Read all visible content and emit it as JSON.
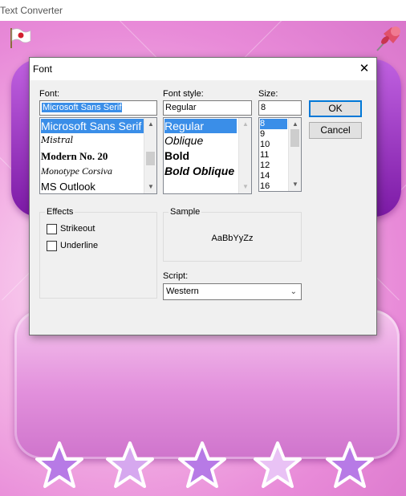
{
  "app": {
    "title": "Text Converter"
  },
  "dialog": {
    "title": "Font",
    "close_glyph": "✕",
    "font": {
      "label": "Font:",
      "value": "Microsoft Sans Serif",
      "items": [
        "Microsoft Sans Serif",
        "Mistral",
        "Modern No. 20",
        "Monotype Corsiva",
        "MS Outlook"
      ],
      "selected": "Microsoft Sans Serif"
    },
    "style": {
      "label": "Font style:",
      "value": "Regular",
      "items": [
        "Regular",
        "Oblique",
        "Bold",
        "Bold Oblique"
      ],
      "selected": "Regular"
    },
    "size": {
      "label": "Size:",
      "value": "8",
      "items": [
        "8",
        "9",
        "10",
        "11",
        "12",
        "14",
        "16"
      ],
      "selected": "8"
    },
    "buttons": {
      "ok": "OK",
      "cancel": "Cancel"
    },
    "effects": {
      "title": "Effects",
      "strikeout": "Strikeout",
      "underline": "Underline"
    },
    "sample": {
      "title": "Sample",
      "text": "AaBbYyZz"
    },
    "script": {
      "label": "Script:",
      "value": "Western"
    }
  },
  "icons": {
    "flag": "flag-icon",
    "pin": "pushpin-icon",
    "star": "star-icon",
    "scroll_up": "▲",
    "scroll_down": "▼",
    "dropdown": "⌄"
  },
  "colors": {
    "selection": "#3a8ee8",
    "default_button_border": "#0078d7",
    "card_purple": "#7c1aa6",
    "background_pink": "#e88ad8",
    "star_fill": "#b77ae6"
  }
}
